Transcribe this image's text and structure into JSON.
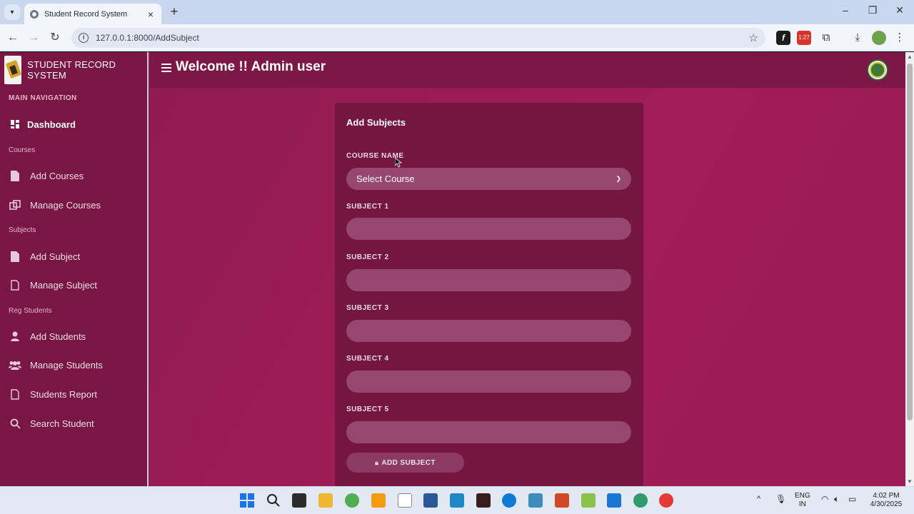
{
  "browser": {
    "tab_title": "Student Record System",
    "url": "127.0.0.1:8000/AddSubject",
    "ext_badge": "1:27"
  },
  "sidebar": {
    "brand": "STUDENT RECORD SYSTEM",
    "main_nav_header": "MAIN NAVIGATION",
    "dashboard": "Dashboard",
    "sections": {
      "courses": "Courses",
      "subjects": "Subjects",
      "reg_students": "Reg Students"
    },
    "items": {
      "add_courses": "Add Courses",
      "manage_courses": "Manage Courses",
      "add_subject": "Add Subject",
      "manage_subject": "Manage Subject",
      "add_students": "Add Students",
      "manage_students": "Manage Students",
      "students_report": "Students Report",
      "search_student": "Search Student"
    }
  },
  "header": {
    "welcome": "Welcome !! Admin user"
  },
  "form": {
    "title": "Add Subjects",
    "course_label": "COURSE NAME",
    "course_selected": "Select Course",
    "subject_labels": [
      "SUBJECT 1",
      "SUBJECT 2",
      "SUBJECT 3",
      "SUBJECT 4",
      "SUBJECT 5"
    ],
    "subject_values": [
      "",
      "",
      "",
      "",
      ""
    ],
    "submit_label": "ADD SUBJECT"
  },
  "taskbar": {
    "lang": "ENG",
    "region": "IN",
    "time": "4:02 PM",
    "date": "4/30/2025"
  },
  "colors": {
    "accent": "#8b1a4e",
    "sidebar": "#7a1644",
    "card": "#741640",
    "field": "#97476d"
  }
}
